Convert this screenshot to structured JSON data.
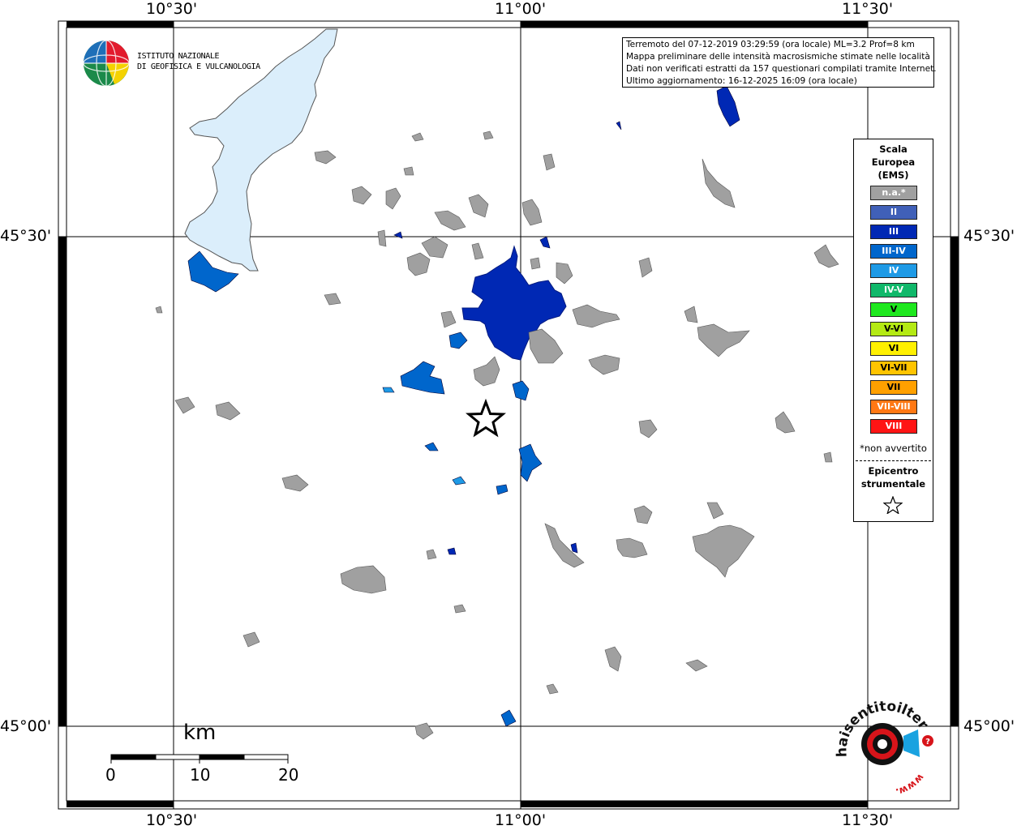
{
  "map": {
    "lon_labels": [
      "10°30'",
      "11°00'",
      "11°30'"
    ],
    "lat_labels": [
      "45°30'",
      "45°00'"
    ]
  },
  "institute": {
    "line1": "ISTITUTO NAZIONALE",
    "line2": "DI GEOFISICA E VULCANOLOGIA"
  },
  "info": {
    "line1": "Terremoto del 07-12-2019 03:29:59 (ora locale) ML=3.2 Prof=8 km",
    "line2": "Mappa preliminare delle intensità macrosismiche stimate nelle località",
    "line3": "Dati non verificati estratti da 157 questionari compilati tramite Internet.",
    "line4": "Ultimo aggiornamento: 16-12-2025 16:09 (ora locale)"
  },
  "legend": {
    "title_1": "Scala",
    "title_2": "Europea",
    "title_3": "(EMS)",
    "levels": [
      {
        "label": "n.a.*",
        "color": "#a0a0a0"
      },
      {
        "label": "II",
        "color": "#4060b8"
      },
      {
        "label": "III",
        "color": "#0028b4"
      },
      {
        "label": "III-IV",
        "color": "#0066cc"
      },
      {
        "label": "IV",
        "color": "#1e9ae6"
      },
      {
        "label": "IV-V",
        "color": "#10b86a"
      },
      {
        "label": "V",
        "color": "#1ee81e"
      },
      {
        "label": "V-VI",
        "color": "#b4ea14"
      },
      {
        "label": "VI",
        "color": "#fff000"
      },
      {
        "label": "VI-VII",
        "color": "#ffc400"
      },
      {
        "label": "VII",
        "color": "#ffa000"
      },
      {
        "label": "VII-VIII",
        "color": "#ff7814"
      },
      {
        "label": "VIII",
        "color": "#ff1414"
      }
    ],
    "note": "*non avvertito",
    "epicenter_1": "Epicentro",
    "epicenter_2": "strumentale"
  },
  "scale_bar": {
    "unit": "km",
    "ticks": [
      "0",
      "10",
      "20"
    ]
  },
  "site_logo": {
    "text": "haisentitoilterremoto.it",
    "url": "www."
  },
  "colors": {
    "lake": "#dbeefb",
    "not_felt": "#a0a0a0",
    "iii": "#0028b4",
    "iii_iv": "#0066cc",
    "iv": "#1e9ae6"
  }
}
